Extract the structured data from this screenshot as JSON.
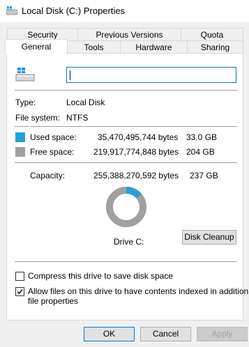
{
  "window": {
    "title": "Local Disk (C:) Properties"
  },
  "tabs": {
    "row1": [
      "Security",
      "Previous Versions",
      "Quota"
    ],
    "row2": [
      "General",
      "Tools",
      "Hardware",
      "Sharing"
    ]
  },
  "general": {
    "name_value": "",
    "type_label": "Type:",
    "type_value": "Local Disk",
    "fs_label": "File system:",
    "fs_value": "NTFS",
    "used_label": "Used space:",
    "used_bytes": "35,470,495,744 bytes",
    "used_gb": "33.0 GB",
    "free_label": "Free space:",
    "free_bytes": "219,917,774,848 bytes",
    "free_gb": "204 GB",
    "capacity_label": "Capacity:",
    "capacity_bytes": "255,388,270,592 bytes",
    "capacity_gb": "237 GB",
    "drive_label": "Drive C:",
    "disk_cleanup_label": "Disk Cleanup",
    "used_fraction": 0.139,
    "colors": {
      "used": "#26a0da",
      "free": "#a0a0a0"
    }
  },
  "options": {
    "compress_label": "Compress this drive to save disk space",
    "compress_checked": false,
    "index_label_line1": "Allow files on this drive to have contents indexed in addition to",
    "index_label_line2": "file properties",
    "index_checked": true
  },
  "buttons": {
    "ok": "OK",
    "cancel": "Cancel",
    "apply": "Apply"
  }
}
